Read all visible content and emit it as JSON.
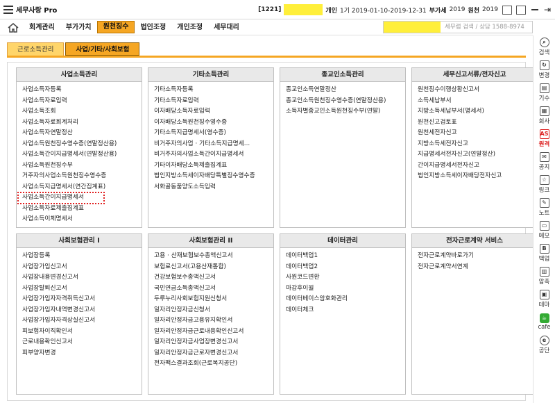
{
  "titlebar": {
    "title": "세무사랑 Pro",
    "code": "[1221]",
    "type": "개인",
    "period": "1기 2019-01-10-2019-12-31",
    "vat_label": "부가세",
    "vat_year": "2019",
    "withholding_label": "원천",
    "withholding_year": "2019"
  },
  "nav": {
    "tabs": [
      "회계관리",
      "부가가치",
      "원천징수",
      "법인조정",
      "개인조정",
      "세무대리"
    ],
    "active_tab": "원천징수",
    "search_text": "세무랩 검색 / 상담 1588-8974"
  },
  "subtabs": {
    "items": [
      "근로소득관리",
      "사업/기타/사회보험"
    ],
    "active": "사업/기타/사회보험"
  },
  "panels": [
    {
      "title": "사업소득관리",
      "items": [
        "사업소득자등록",
        "사업소득자료입력",
        "사업소득조회",
        "사업소득자료회계처리",
        "사업소득자연말정산",
        "사업소득원천징수영수증(연말정산용)",
        "사업소득간이지급명세서(연말정산용)",
        "사업소득원천징수부",
        "거주자의사업소득원천징수영수증",
        "사업소득지급명세서(연간집계표)",
        "사업소득간이지급명세서",
        "사업소득자료제출집계표",
        "사업소득이체명세서"
      ],
      "highlighted": "사업소득간이지급명세서"
    },
    {
      "title": "기타소득관리",
      "items": [
        "기타소득자등록",
        "기타소득자료입력",
        "이자배당소득자료입력",
        "이자배당소득원천징수영수증",
        "기타소득지급명세서(영수증)",
        "비거주자의사업 · 기타소득지급명세...",
        "비거주자의사업소득간이지급명세서",
        "기타이자배당소득제출집계표",
        "법인지방소득세이자배당특별징수영수증",
        "서화골동품양도소득입력"
      ]
    },
    {
      "title": "종교인소득관리",
      "items": [
        "종교인소득연말정산",
        "종교인소득원천징수영수증(연말정산용)",
        "소득자별종교인소득원천징수부(연말)"
      ]
    },
    {
      "title": "세무신고서류/전자신고",
      "items": [
        "원천징수이행상황신고서",
        "소득세납부서",
        "지방소득세납부서(명세서)",
        "원천신고검토표",
        "원천세전자신고",
        "지방소득세전자신고",
        "지급명세서전자신고(연말정산)",
        "간이지급명세서전자신고",
        "법인지방소득세이자배당전자신고"
      ]
    },
    {
      "title": "사회보험관리 I",
      "items": [
        "사업장등록",
        "사업장가입신고서",
        "사업장내용변경신고서",
        "사업장탈퇴신고서",
        "사업장가입자자격취득신고서",
        "사업장가입자내역변경신고서",
        "사업장가입자자격상실신고서",
        "피보험자이직확인서",
        "근로내용확인신고서",
        "피부양자변경"
      ]
    },
    {
      "title": "사회보험관리 II",
      "items": [
        "고용 · 산재보험보수총액신고서",
        "보험료신고서(고용산재통합)",
        "건강보험보수총액신고서",
        "국민연금소득총액신고서",
        "두루누리사회보험지원신청서",
        "일자리안정자금신청서",
        "일자리안정자금고용유지확인서",
        "일자리안정자금근로내용확인신고서",
        "일자리안정자금사업장변경신고서",
        "일자리안정자금근로자변경신고서",
        "전자팩스결과조회(근로복지공단)"
      ]
    },
    {
      "title": "데이터관리",
      "items": [
        "데이터백업1",
        "데이터백업2",
        "사원코드변환",
        "마감후이월",
        "데이터베이스암호화관리",
        "데이터체크"
      ]
    },
    {
      "title": "전자근로계약 서비스",
      "items": [
        "전자근로계약바로가기",
        "전자근로계약서연계"
      ]
    }
  ],
  "sidebar": {
    "items": [
      {
        "label": "검색",
        "icon": "search-icon",
        "glyph": "⌕"
      },
      {
        "label": "변경",
        "icon": "change-icon",
        "glyph": "↻"
      },
      {
        "label": "기수",
        "icon": "period-icon",
        "glyph": "▤"
      },
      {
        "label": "회사",
        "icon": "company-icon",
        "glyph": "▦"
      },
      {
        "label": "원격",
        "icon": "remote-icon",
        "glyph": "AS"
      },
      {
        "label": "공지",
        "icon": "notice-icon",
        "glyph": "✉"
      },
      {
        "label": "링크",
        "icon": "link-icon",
        "glyph": "☆"
      },
      {
        "label": "노트",
        "icon": "note-icon",
        "glyph": "✎"
      },
      {
        "label": "메모",
        "icon": "memo-icon",
        "glyph": "▭"
      },
      {
        "label": "백업",
        "icon": "backup-icon",
        "glyph": "B"
      },
      {
        "label": "압축",
        "icon": "compress-icon",
        "glyph": "▥"
      },
      {
        "label": "테마",
        "icon": "theme-icon",
        "glyph": "▣"
      },
      {
        "label": "cafe",
        "icon": "cafe-icon",
        "glyph": "☕"
      },
      {
        "label": "공단",
        "icon": "agency-icon",
        "glyph": "e"
      }
    ]
  },
  "colors": {
    "accent": "#f5a623",
    "highlight_yellow": "#ffef3a",
    "remote_red": "#dd2222"
  }
}
